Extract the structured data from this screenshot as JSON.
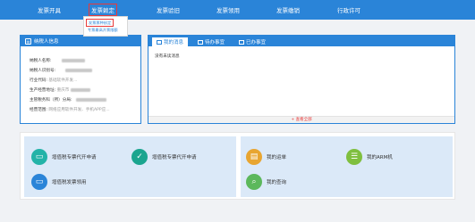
{
  "nav": {
    "items": [
      "发票开具",
      "发票赖定",
      "发票验旧",
      "发票领用",
      "发票缴销",
      "行政许可"
    ],
    "active_index": 1
  },
  "dropdown": {
    "items": [
      "发票票种核定",
      "专票最高开票限额"
    ]
  },
  "taxpayer": {
    "title": "纳税人信息",
    "rows": [
      {
        "label": "纳税人名称:",
        "value": ""
      },
      {
        "label": "纳税人识别号:",
        "value": ""
      },
      {
        "label": "行业代码:",
        "value": "基础软件开发..."
      },
      {
        "label": "生产经营地址:",
        "value": "重庆市"
      },
      {
        "label": "主管税务科（所）分局:",
        "value": ""
      },
      {
        "label": "经营范围:",
        "value": "网络应用软件开发、手机APP应..."
      }
    ]
  },
  "messages": {
    "tabs": [
      "我的消息",
      "待办事宜",
      "已办事宜"
    ],
    "empty_text": "没有未读消息",
    "view_all": "+ 查看全部"
  },
  "quick_links": {
    "left": [
      {
        "label": "增值税专票代开申请",
        "icon": "inbox-icon",
        "color": "#23b3a8"
      },
      {
        "label": "增值税专票代开申请",
        "icon": "check-icon",
        "color": "#1ba58f"
      },
      {
        "label": "增值税发票领用",
        "icon": "inbox-icon",
        "color": "#2a84d8"
      }
    ],
    "right": [
      {
        "label": "我的运单",
        "icon": "clipboard-icon",
        "color": "#e8a531"
      },
      {
        "label": "我的ARM机",
        "icon": "list-icon",
        "color": "#7fbf3f"
      },
      {
        "label": "我的查询",
        "icon": "magnifier-icon",
        "color": "#5cb85c"
      }
    ]
  },
  "colors": {
    "primary": "#2a84d8",
    "highlight": "#e83a3a",
    "quick_bg": "#dbe9f8"
  }
}
